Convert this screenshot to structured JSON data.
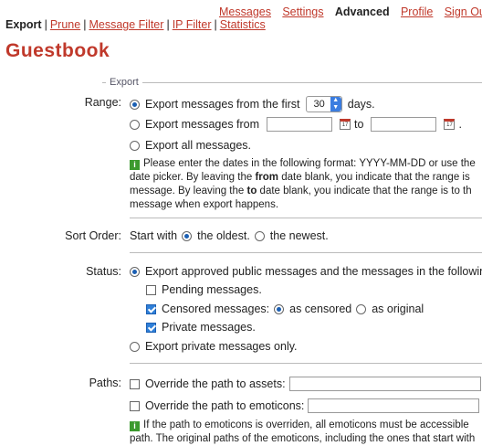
{
  "topnav": {
    "messages": "Messages",
    "settings": "Settings",
    "advanced": "Advanced",
    "profile": "Profile",
    "signout": "Sign Out"
  },
  "subnav": {
    "export": "Export",
    "prune": "Prune",
    "message_filter": "Message Filter",
    "ip_filter": "IP Filter",
    "statistics": "Statistics",
    "separator": "|"
  },
  "page_title": "Guestbook",
  "fieldset_legend": "Export",
  "range": {
    "label": "Range:",
    "opt_first_prefix": "Export messages from the first",
    "days_value": "30",
    "opt_first_suffix": "days.",
    "opt_from": "Export messages from",
    "to": "to",
    "period": ".",
    "opt_all": "Export all messages.",
    "info_line1": "Please enter the dates in the following format: YYYY-MM-DD or use the",
    "info_line2a": "date picker. By leaving the ",
    "info_line2b": "from",
    "info_line2c": " date blank, you indicate that the range is",
    "info_line3a": "message. By leaving the ",
    "info_line3b": "to",
    "info_line3c": " date blank, you indicate that the range is to th",
    "info_line4": "message when export happens."
  },
  "sort": {
    "label": "Sort Order:",
    "prefix": "Start with",
    "oldest": "the oldest.",
    "newest": "the newest."
  },
  "status": {
    "label": "Status:",
    "opt_public": "Export approved public messages and the messages in the following",
    "pending": "Pending messages.",
    "censored": "Censored messages:",
    "as_censored": "as censored",
    "as_original": "as original",
    "private": "Private messages.",
    "opt_private_only": "Export private messages only."
  },
  "paths": {
    "label": "Paths:",
    "assets": "Override the path to assets:",
    "emoticons": "Override the path to emoticons:",
    "info_line1": "If the path to emoticons is overriden, all emoticons must be accessible",
    "info_line2": "path. The original paths of the emoticons, including the ones that start with"
  },
  "icons": {
    "info": "info-icon",
    "calendar": "calendar-icon"
  },
  "colors": {
    "accent": "#c0392b",
    "info_green": "#3c9a2e",
    "control_blue": "#2f7fd8"
  }
}
